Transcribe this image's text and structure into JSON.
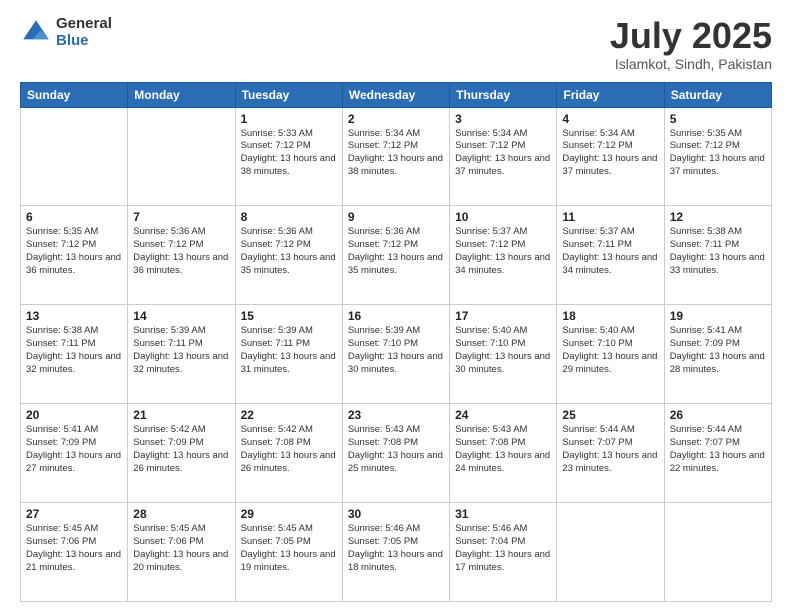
{
  "logo": {
    "general": "General",
    "blue": "Blue"
  },
  "title": "July 2025",
  "subtitle": "Islamkot, Sindh, Pakistan",
  "weekdays": [
    "Sunday",
    "Monday",
    "Tuesday",
    "Wednesday",
    "Thursday",
    "Friday",
    "Saturday"
  ],
  "weeks": [
    [
      {
        "day": "",
        "info": ""
      },
      {
        "day": "",
        "info": ""
      },
      {
        "day": "1",
        "info": "Sunrise: 5:33 AM\nSunset: 7:12 PM\nDaylight: 13 hours and 38 minutes."
      },
      {
        "day": "2",
        "info": "Sunrise: 5:34 AM\nSunset: 7:12 PM\nDaylight: 13 hours and 38 minutes."
      },
      {
        "day": "3",
        "info": "Sunrise: 5:34 AM\nSunset: 7:12 PM\nDaylight: 13 hours and 37 minutes."
      },
      {
        "day": "4",
        "info": "Sunrise: 5:34 AM\nSunset: 7:12 PM\nDaylight: 13 hours and 37 minutes."
      },
      {
        "day": "5",
        "info": "Sunrise: 5:35 AM\nSunset: 7:12 PM\nDaylight: 13 hours and 37 minutes."
      }
    ],
    [
      {
        "day": "6",
        "info": "Sunrise: 5:35 AM\nSunset: 7:12 PM\nDaylight: 13 hours and 36 minutes."
      },
      {
        "day": "7",
        "info": "Sunrise: 5:36 AM\nSunset: 7:12 PM\nDaylight: 13 hours and 36 minutes."
      },
      {
        "day": "8",
        "info": "Sunrise: 5:36 AM\nSunset: 7:12 PM\nDaylight: 13 hours and 35 minutes."
      },
      {
        "day": "9",
        "info": "Sunrise: 5:36 AM\nSunset: 7:12 PM\nDaylight: 13 hours and 35 minutes."
      },
      {
        "day": "10",
        "info": "Sunrise: 5:37 AM\nSunset: 7:12 PM\nDaylight: 13 hours and 34 minutes."
      },
      {
        "day": "11",
        "info": "Sunrise: 5:37 AM\nSunset: 7:11 PM\nDaylight: 13 hours and 34 minutes."
      },
      {
        "day": "12",
        "info": "Sunrise: 5:38 AM\nSunset: 7:11 PM\nDaylight: 13 hours and 33 minutes."
      }
    ],
    [
      {
        "day": "13",
        "info": "Sunrise: 5:38 AM\nSunset: 7:11 PM\nDaylight: 13 hours and 32 minutes."
      },
      {
        "day": "14",
        "info": "Sunrise: 5:39 AM\nSunset: 7:11 PM\nDaylight: 13 hours and 32 minutes."
      },
      {
        "day": "15",
        "info": "Sunrise: 5:39 AM\nSunset: 7:11 PM\nDaylight: 13 hours and 31 minutes."
      },
      {
        "day": "16",
        "info": "Sunrise: 5:39 AM\nSunset: 7:10 PM\nDaylight: 13 hours and 30 minutes."
      },
      {
        "day": "17",
        "info": "Sunrise: 5:40 AM\nSunset: 7:10 PM\nDaylight: 13 hours and 30 minutes."
      },
      {
        "day": "18",
        "info": "Sunrise: 5:40 AM\nSunset: 7:10 PM\nDaylight: 13 hours and 29 minutes."
      },
      {
        "day": "19",
        "info": "Sunrise: 5:41 AM\nSunset: 7:09 PM\nDaylight: 13 hours and 28 minutes."
      }
    ],
    [
      {
        "day": "20",
        "info": "Sunrise: 5:41 AM\nSunset: 7:09 PM\nDaylight: 13 hours and 27 minutes."
      },
      {
        "day": "21",
        "info": "Sunrise: 5:42 AM\nSunset: 7:09 PM\nDaylight: 13 hours and 26 minutes."
      },
      {
        "day": "22",
        "info": "Sunrise: 5:42 AM\nSunset: 7:08 PM\nDaylight: 13 hours and 26 minutes."
      },
      {
        "day": "23",
        "info": "Sunrise: 5:43 AM\nSunset: 7:08 PM\nDaylight: 13 hours and 25 minutes."
      },
      {
        "day": "24",
        "info": "Sunrise: 5:43 AM\nSunset: 7:08 PM\nDaylight: 13 hours and 24 minutes."
      },
      {
        "day": "25",
        "info": "Sunrise: 5:44 AM\nSunset: 7:07 PM\nDaylight: 13 hours and 23 minutes."
      },
      {
        "day": "26",
        "info": "Sunrise: 5:44 AM\nSunset: 7:07 PM\nDaylight: 13 hours and 22 minutes."
      }
    ],
    [
      {
        "day": "27",
        "info": "Sunrise: 5:45 AM\nSunset: 7:06 PM\nDaylight: 13 hours and 21 minutes."
      },
      {
        "day": "28",
        "info": "Sunrise: 5:45 AM\nSunset: 7:06 PM\nDaylight: 13 hours and 20 minutes."
      },
      {
        "day": "29",
        "info": "Sunrise: 5:45 AM\nSunset: 7:05 PM\nDaylight: 13 hours and 19 minutes."
      },
      {
        "day": "30",
        "info": "Sunrise: 5:46 AM\nSunset: 7:05 PM\nDaylight: 13 hours and 18 minutes."
      },
      {
        "day": "31",
        "info": "Sunrise: 5:46 AM\nSunset: 7:04 PM\nDaylight: 13 hours and 17 minutes."
      },
      {
        "day": "",
        "info": ""
      },
      {
        "day": "",
        "info": ""
      }
    ]
  ]
}
